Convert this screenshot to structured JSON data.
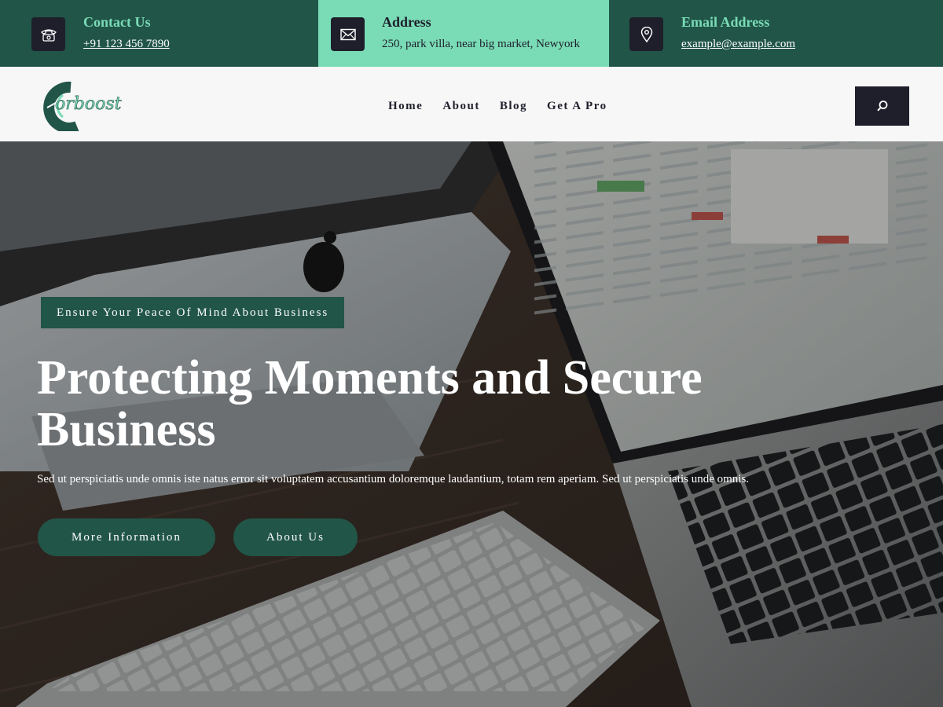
{
  "topbar": {
    "contact": {
      "title": "Contact Us",
      "value": "+91 123 456 7890",
      "icon": "phone-icon"
    },
    "address": {
      "title": "Address",
      "value": "250, park villa, near big market, Newyork",
      "icon": "mail-icon"
    },
    "email": {
      "title": "Email Address",
      "value": "example@example.com",
      "icon": "location-pin-icon"
    }
  },
  "header": {
    "logo_text": "Corboost",
    "nav": [
      "Home",
      "About",
      "Blog",
      "Get A Pro"
    ],
    "search_icon": "search-icon"
  },
  "hero": {
    "tagline": "Ensure Your Peace Of Mind About Business",
    "title": "Protecting Moments and Secure Business",
    "description": "Sed ut perspiciatis unde omnis iste natus error sit voluptatem accusantium doloremque laudantium, totam rem aperiam. Sed ut perspiciatis unde omnis.",
    "buttons": [
      "More Information",
      "About Us"
    ]
  },
  "colors": {
    "primary_green": "#215548",
    "accent_mint": "#7adcb6",
    "dark": "#1e1f2b"
  }
}
